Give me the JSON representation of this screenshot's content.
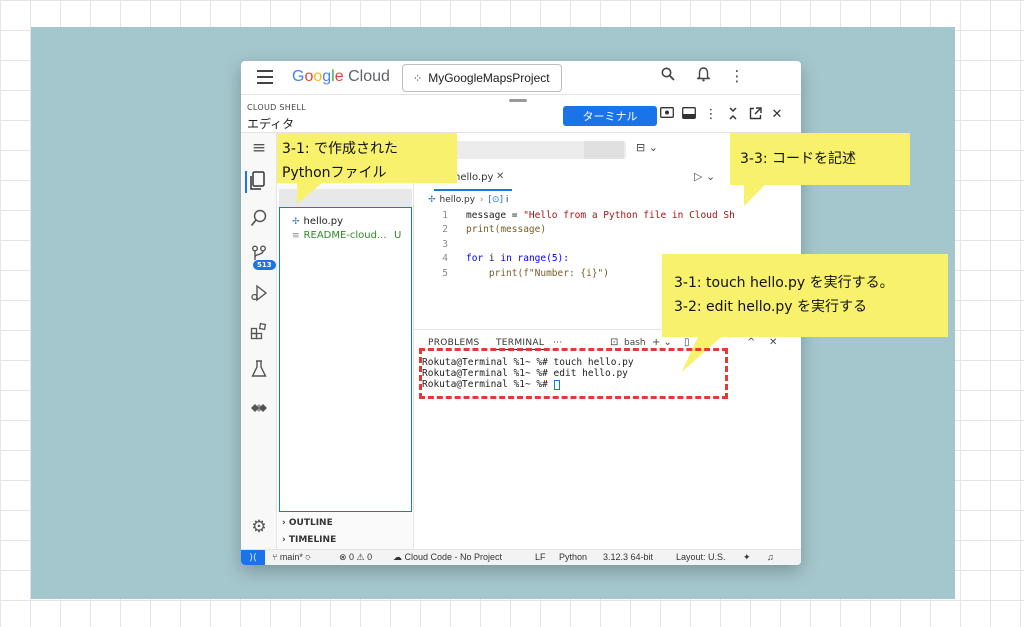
{
  "topbar": {
    "logo_google": "Google",
    "logo_cloud": "Cloud",
    "project_name": "MyGoogleMapsProject",
    "icons": [
      "menu-icon",
      "search-icon",
      "notifications-icon",
      "more-vert-icon"
    ]
  },
  "shell": {
    "section_label": "CLOUD SHELL",
    "mode_label": "エディタ",
    "terminal_button": "ターミナル",
    "header_icons": [
      "preview-icon",
      "panel-icon",
      "more-icon",
      "collapse-icon",
      "open-new-window-icon",
      "close-icon"
    ]
  },
  "activity_bar": {
    "icons": [
      "menu-icon",
      "explorer-icon",
      "search-icon",
      "source-control-icon",
      "run-debug-icon",
      "extensions-icon",
      "testing-icon",
      "cloud-code-icon",
      "settings-gear-icon"
    ],
    "scm_badge": "513"
  },
  "explorer": {
    "files": [
      {
        "name": "hello.py",
        "status": ""
      },
      {
        "name": "README-cloud...",
        "status": "U"
      }
    ],
    "sections": [
      "OUTLINE",
      "TIMELINE"
    ]
  },
  "editor": {
    "tab_label": "hello.py",
    "tab_close": "✕",
    "breadcrumb_file": "hello.py",
    "breadcrumb_symbol_icon": "[⊙]",
    "breadcrumb_symbol": "i",
    "code_lines": [
      {
        "n": "1",
        "a": "message = ",
        "b": "\"Hello from a Python file in Cloud Sh",
        "c": ""
      },
      {
        "n": "2",
        "a": "print(message)",
        "b": "",
        "c": ""
      },
      {
        "n": "3",
        "a": "",
        "b": "",
        "c": ""
      },
      {
        "n": "4",
        "a": "for",
        "b": " i ",
        "c": "in range(5):"
      },
      {
        "n": "5",
        "a": "    print(f\"Number: {i}\")",
        "b": "",
        "c": ""
      }
    ]
  },
  "panel": {
    "tabs": [
      "PROBLEMS",
      "TERMINAL",
      "···"
    ],
    "shell_name": "bash",
    "terminal_lines": [
      "Rokuta@Terminal %1~ %# touch hello.py",
      "Rokuta@Terminal %1~ %# edit hello.py",
      "Rokuta@Terminal %1~ %# "
    ]
  },
  "statusbar": {
    "branch": "main*",
    "problems": "⊗ 0 ⚠ 0",
    "cloud_code": "Cloud Code - No Project",
    "eol": "LF",
    "language": "Python",
    "python_version": "3.12.3 64-bit",
    "layout": "Layout: U.S."
  },
  "annotations": {
    "callout_1": "3-1: で作成された\nPythonファイル",
    "callout_2": "3-3: コードを記述",
    "callout_3": "3-1: touch hello.py を実行する。\n3-2: edit hello.py を実行する",
    "colors": {
      "callout": "#f7f16b",
      "highlight": "#e53935",
      "accent": "#1a73e8",
      "backdrop": "#a4c7cd"
    }
  }
}
